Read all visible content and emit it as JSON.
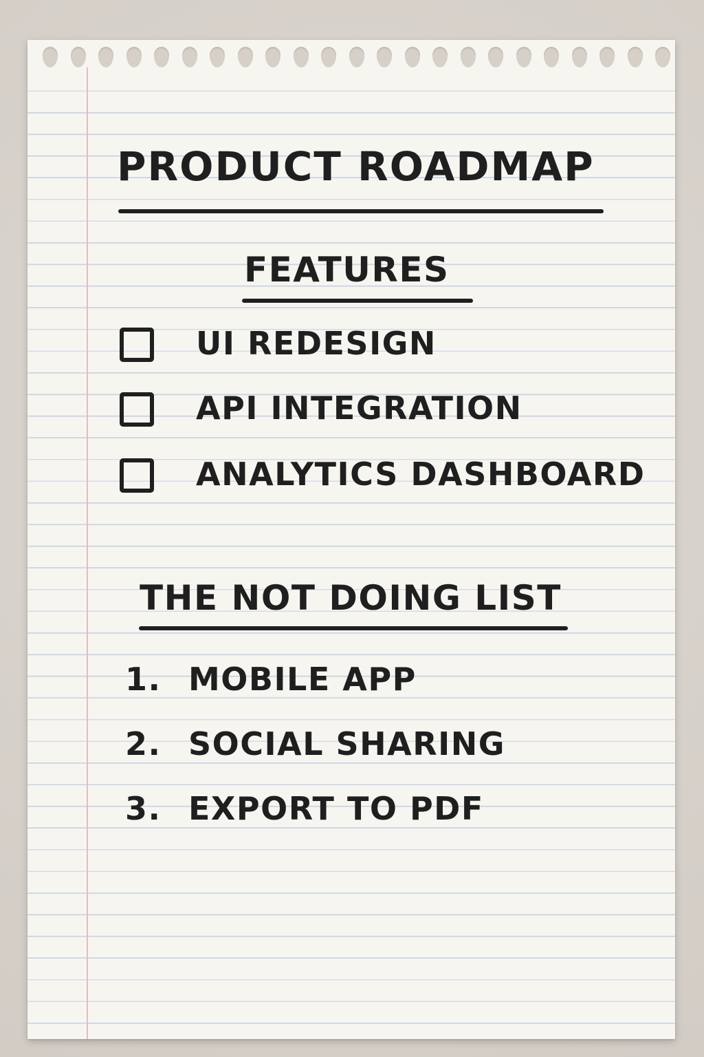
{
  "page": {
    "colors": {
      "ink": "#1f1f1f",
      "paper": "#f7f5f0",
      "rule_line": "#c9d3e3",
      "margin_line": "#e7b9c4",
      "background": "#d8d3cd"
    }
  },
  "note": {
    "title": "PRODUCT ROADMAP",
    "features": {
      "heading": "FEATURES",
      "items": [
        {
          "label": "UI REDESIGN",
          "checked": false
        },
        {
          "label": "API INTEGRATION",
          "checked": false
        },
        {
          "label": "ANALYTICS DASHBOARD",
          "checked": false
        }
      ]
    },
    "not_doing": {
      "heading": "THE NOT DOING LIST",
      "items": [
        {
          "number": "1.",
          "label": "MOBILE APP"
        },
        {
          "number": "2.",
          "label": "SOCIAL SHARING"
        },
        {
          "number": "3.",
          "label": "EXPORT TO PDF"
        }
      ]
    }
  }
}
